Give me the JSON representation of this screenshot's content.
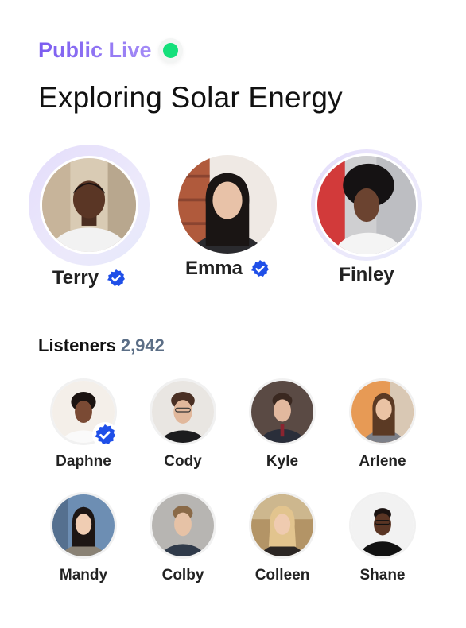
{
  "header": {
    "live_label": "Public Live",
    "live_dot_color": "#14e07b",
    "title": "Exploring Solar Energy"
  },
  "speakers": [
    {
      "name": "Terry",
      "verified": true,
      "ring": "active"
    },
    {
      "name": "Emma",
      "verified": true,
      "ring": "none"
    },
    {
      "name": "Finley",
      "verified": false,
      "ring": "thin"
    }
  ],
  "listeners_section": {
    "label": "Listeners",
    "count": "2,942"
  },
  "listeners": [
    {
      "name": "Daphne",
      "verified": true
    },
    {
      "name": "Cody",
      "verified": false
    },
    {
      "name": "Kyle",
      "verified": false
    },
    {
      "name": "Arlene",
      "verified": false
    },
    {
      "name": "Mandy",
      "verified": false
    },
    {
      "name": "Colby",
      "verified": false
    },
    {
      "name": "Colleen",
      "verified": false
    },
    {
      "name": "Shane",
      "verified": false
    }
  ],
  "colors": {
    "accent": "#7b5cf0",
    "verified_blue": "#1f4fe8",
    "count_color": "#5b6e86"
  },
  "icons": {
    "verified": "verified-badge-icon",
    "live": "live-dot-icon"
  }
}
